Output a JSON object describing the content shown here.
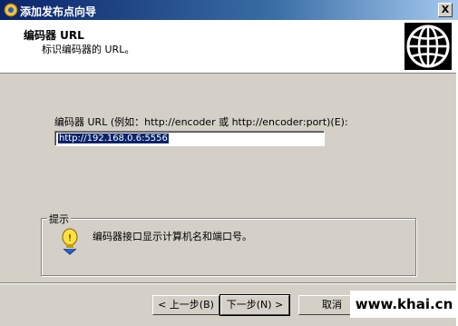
{
  "window": {
    "title": "添加发布点向导",
    "close_label": "X"
  },
  "header": {
    "title": "编码器 URL",
    "subtitle": "标识编码器的 URL。",
    "icon": "globe-icon"
  },
  "form": {
    "label": "编码器 URL (例如：http://encoder 或 http://encoder:port)(E):",
    "url_value": "http://192.168.0.6:5556"
  },
  "hint": {
    "legend": "提示",
    "text": "编码器接口显示计算机名和端口号。",
    "icon": "lightbulb-icon"
  },
  "buttons": {
    "back": "< 上一步(B)",
    "next": "下一步(N) >",
    "cancel": "取消"
  },
  "watermark": "www.khai.cn"
}
